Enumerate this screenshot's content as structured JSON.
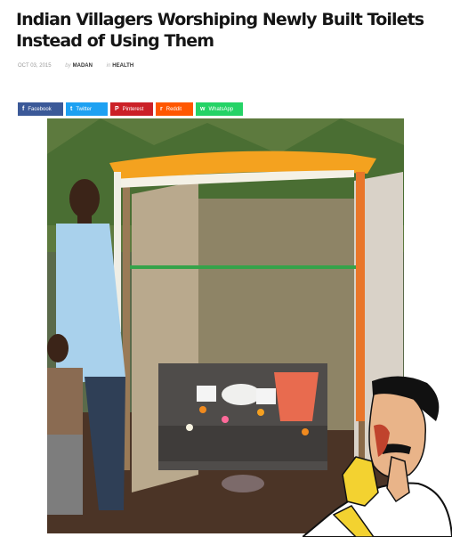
{
  "article": {
    "title": "Indian Villagers Worshiping Newly Built Toilets Instead of Using Them",
    "date": "OCT 03, 2015",
    "author_prefix": "by",
    "author": "MADAN",
    "category_prefix": "in",
    "category": "HEALTH"
  },
  "share": [
    {
      "label": "Facebook",
      "icon": "f",
      "color": "#3b5998"
    },
    {
      "label": "Twitter",
      "icon": "t",
      "color": "#1da1f2"
    },
    {
      "label": "Pinterest",
      "icon": "P",
      "color": "#cb2027"
    },
    {
      "label": "Reddit",
      "icon": "r",
      "color": "#ff5700"
    },
    {
      "label": "WhatsApp",
      "icon": "w",
      "color": "#25d366"
    }
  ],
  "colors": {
    "marigold": "#f4a21f",
    "tarp": "#8e8466",
    "bucket": "#e86b4f",
    "meme_yellow": "#f3d230"
  }
}
